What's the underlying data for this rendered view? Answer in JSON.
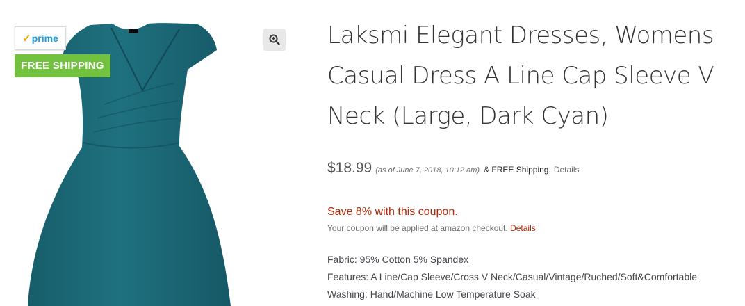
{
  "badges": {
    "prime_label": "prime",
    "free_shipping": "FREE SHIPPING"
  },
  "product": {
    "title": "Laksmi Elegant Dresses, Womens Casual Dress A Line Cap Sleeve V Neck (Large, Dark Cyan)",
    "price": "$18.99",
    "price_date": "(as of June 7, 2018, 10:12 am)",
    "shipping_prefix": "&",
    "shipping_label": "FREE Shipping.",
    "details_link": "Details",
    "dress_color": "#1d6a78"
  },
  "coupon": {
    "headline": "Save 8% with this coupon.",
    "note": "Your coupon will be applied at amazon checkout.",
    "details_link": "Details"
  },
  "features": [
    "Fabric: 95% Cotton 5% Spandex",
    "Features: A Line/Cap Sleeve/Cross V Neck/Casual/Vintage/Ruched/Soft&Comfortable",
    "Washing: Hand/Machine Low Temperature Soak"
  ]
}
